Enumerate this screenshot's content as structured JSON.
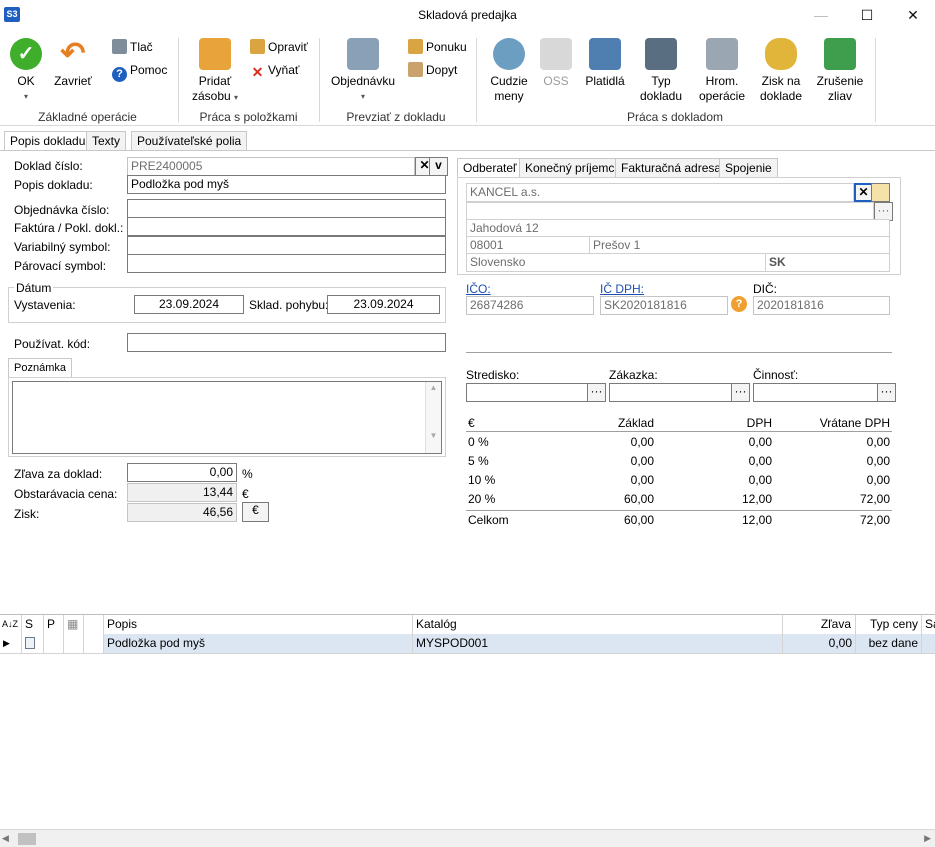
{
  "window": {
    "title": "Skladová predajka",
    "logo": "S3"
  },
  "ribbon": {
    "ok": "OK",
    "zavriet": "Zavrieť",
    "tlac": "Tlač",
    "pomoc": "Pomoc",
    "pridat_zasobu_1": "Pridať",
    "pridat_zasobu_2": "zásobu",
    "opravit": "Opraviť",
    "vynat": "Vyňať",
    "objednavku": "Objednávku",
    "ponuku": "Ponuku",
    "dopyt": "Dopyt",
    "cudzie_meny_1": "Cudzie",
    "cudzie_meny_2": "meny",
    "oss": "OSS",
    "platidla": "Platidlá",
    "typ_dokladu_1": "Typ",
    "typ_dokladu_2": "dokladu",
    "hrom_1": "Hrom.",
    "hrom_2": "operácie",
    "zisk_1": "Zisk na",
    "zisk_2": "doklade",
    "zrusenie_1": "Zrušenie",
    "zrusenie_2": "zliav",
    "groups": {
      "zakladne": "Základné operácie",
      "polozky": "Práca s položkami",
      "prevziat": "Prevziať z dokladu",
      "doklad": "Práca s dokladom"
    }
  },
  "tabs": {
    "popis": "Popis dokladu",
    "texty": "Texty",
    "polia": "Používateľské polia"
  },
  "form": {
    "doklad_cislo_label": "Doklad číslo:",
    "doklad_cislo": "PRE2400005",
    "popis_label": "Popis dokladu:",
    "popis": "Podložka pod myš",
    "objednavka_label": "Objednávka číslo:",
    "faktura_label": "Faktúra / Pokl. dokl.:",
    "variabilny_label": "Variabilný symbol:",
    "parovaci_label": "Párovací symbol:",
    "datum_label": "Dátum",
    "vystavenia_label": "Vystavenia:",
    "vystavenia": "23.09.2024",
    "sklad_label": "Sklad. pohybu:",
    "sklad": "23.09.2024",
    "pouzivat_label": "Používat. kód:",
    "poznamka_tab": "Poznámka",
    "zlava_label": "Zľava za doklad:",
    "zlava": "0,00",
    "zlava_unit": "%",
    "obstaravacia_label": "Obstarávacia cena:",
    "obstaravacia": "13,44",
    "obstaravacia_unit": "€",
    "zisk_label": "Zisk:",
    "zisk": "46,56",
    "zisk_btn": "€",
    "clear_btn": "✕",
    "dropdown_btn": "v"
  },
  "partner": {
    "tabs": {
      "odberatel": "Odberateľ",
      "konecny": "Konečný príjemca",
      "fakturacna": "Fakturačná adresa",
      "spojenie": "Spojenie"
    },
    "name": "KANCEL a.s.",
    "street": "Jahodová 12",
    "zip": "08001",
    "city": "Prešov 1",
    "country": "Slovensko",
    "country_code": "SK",
    "ico_label": "IČO:",
    "ico": "26874286",
    "icdph_label": "IČ DPH:",
    "icdph": "SK2020181816",
    "dic_label": "DIČ:",
    "dic": "2020181816"
  },
  "costs": {
    "stredisko_label": "Stredisko:",
    "zakazka_label": "Zákazka:",
    "cinnost_label": "Činnosť:"
  },
  "vat": {
    "headers": [
      "€",
      "Základ",
      "DPH",
      "Vrátane DPH"
    ],
    "rows": [
      [
        "0 %",
        "0,00",
        "0,00",
        "0,00"
      ],
      [
        "5 %",
        "0,00",
        "0,00",
        "0,00"
      ],
      [
        "10 %",
        "0,00",
        "0,00",
        "0,00"
      ],
      [
        "20 %",
        "60,00",
        "12,00",
        "72,00"
      ]
    ],
    "total": [
      "Celkom",
      "60,00",
      "12,00",
      "72,00"
    ]
  },
  "grid": {
    "headers": {
      "sort": "A↓Z",
      "s": "S",
      "p": "P",
      "popis": "Popis",
      "katalog": "Katalóg",
      "zlava": "Zľava",
      "typ_ceny": "Typ ceny",
      "sa": "Sa"
    },
    "row": {
      "popis": "Podložka pod myš",
      "katalog": "MYSPOD001",
      "zlava": "0,00",
      "typ_ceny": "bez dane"
    }
  },
  "colors": {
    "accent": "#1f5fbf",
    "selection": "#dce6f2"
  }
}
